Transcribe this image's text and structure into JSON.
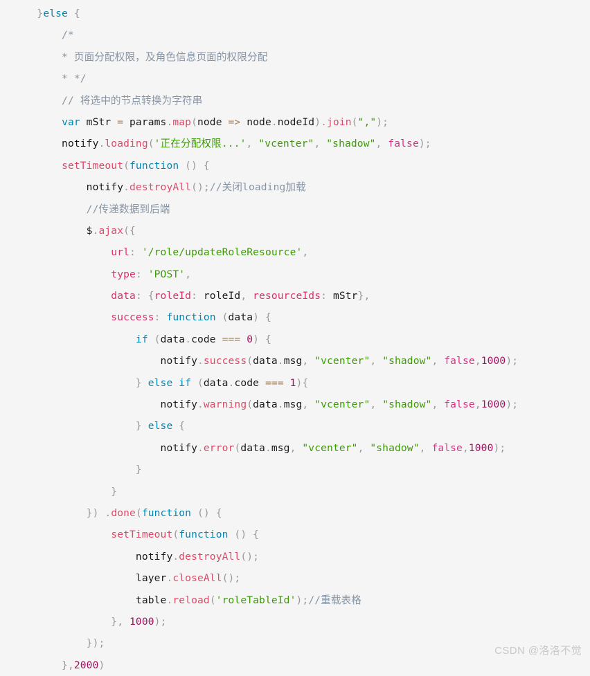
{
  "editor": {
    "background_color": "#f5f5f5",
    "language": "javascript",
    "font_size_px": 14.6,
    "line_height_px": 31.4
  },
  "colors": {
    "plain": "#333333",
    "keyword": "#0086b3",
    "function": "#dd4a68",
    "string": "#3d9a06",
    "number": "#a0125e",
    "boolean": "#d63384",
    "punctuation": "#999999",
    "operator": "#a67f59",
    "object_key": "#d6336c",
    "comment": "#8795a5"
  },
  "watermark": {
    "text": "CSDN @洛洛不觉"
  },
  "code": {
    "lines": [
      "}else {",
      "    /*",
      "    * 页面分配权限，及角色信息页面的权限分配",
      "    * */",
      "    // 将选中的节点转换为字符串",
      "    var mStr = params.map(node => node.nodeId).join(\",\");",
      "    notify.loading('正在分配权限...', \"vcenter\", \"shadow\", false);",
      "    setTimeout(function () {",
      "        notify.destroyAll();//关闭loading加载",
      "        //传递数据到后端",
      "        $.ajax({",
      "            url: '/role/updateRoleResource',",
      "            type: 'POST',",
      "            data: {roleId: roleId, resourceIds: mStr},",
      "            success: function (data) {",
      "                if (data.code === 0) {",
      "                    notify.success(data.msg, \"vcenter\", \"shadow\", false,1000);",
      "                } else if (data.code === 1){",
      "                    notify.warning(data.msg, \"vcenter\", \"shadow\", false,1000);",
      "                } else {",
      "                    notify.error(data.msg, \"vcenter\", \"shadow\", false,1000);",
      "                }",
      "            }",
      "        }) .done(function () {",
      "            setTimeout(function () {",
      "                notify.destroyAll();",
      "                layer.closeAll();",
      "                table.reload('roleTableId');//重载表格",
      "            }, 1000);",
      "        });",
      "    },2000)"
    ]
  }
}
